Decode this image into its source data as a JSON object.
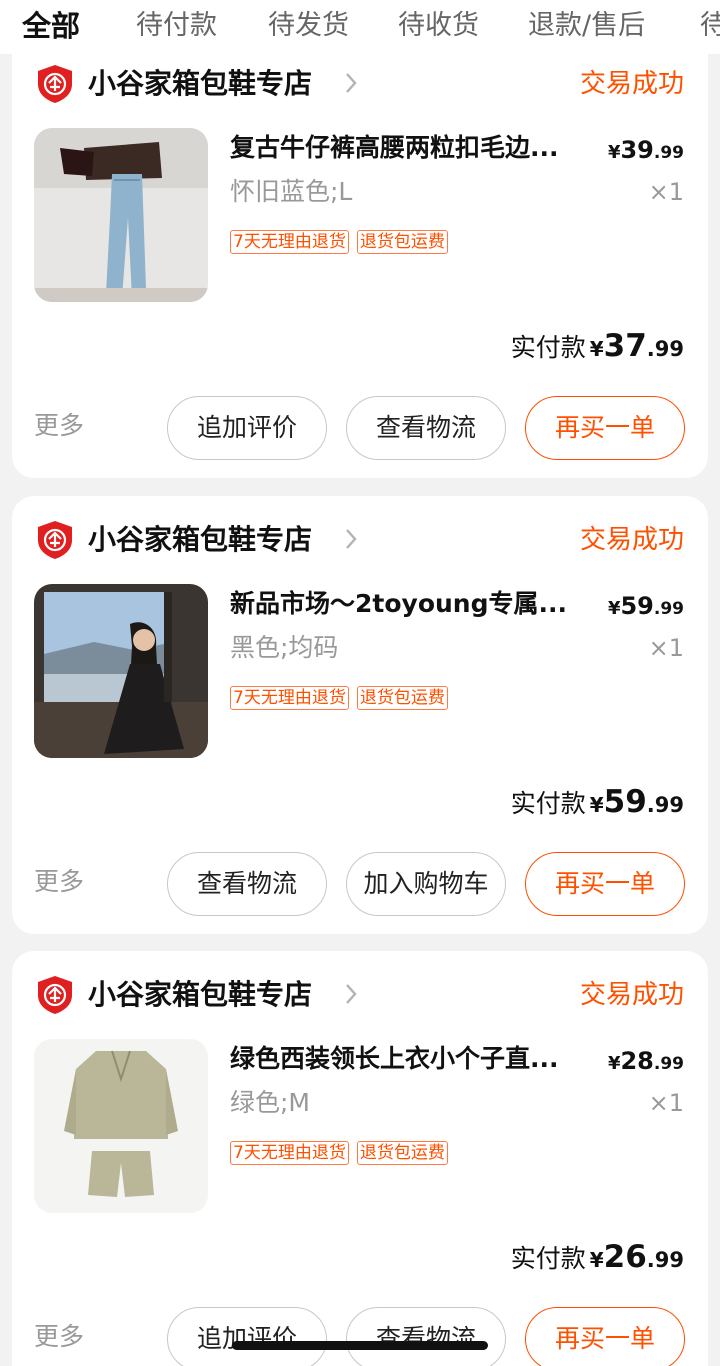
{
  "tabs": [
    "全部",
    "待付款",
    "待发货",
    "待收货",
    "退款/售后",
    "待"
  ],
  "orders": [
    {
      "shop_name": "小谷家箱包鞋专店",
      "status": "交易成功",
      "item_title": "复古牛仔裤高腰两粒扣毛边...",
      "price_currency": "¥",
      "price_int": "39",
      "price_dec": ".99",
      "spec": "怀旧蓝色;L",
      "qty": "×1",
      "tags": [
        "7天无理由退货",
        "退货包运费"
      ],
      "paid_label": "实付款",
      "paid_currency": "¥",
      "paid_int": "37",
      "paid_dec": ".99",
      "more_label": "更多",
      "buttons": [
        "追加评价",
        "查看物流",
        "再买一单"
      ]
    },
    {
      "shop_name": "小谷家箱包鞋专店",
      "status": "交易成功",
      "item_title": "新品市场～2toyoung专属...",
      "price_currency": "¥",
      "price_int": "59",
      "price_dec": ".99",
      "spec": "黑色;均码",
      "qty": "×1",
      "tags": [
        "7天无理由退货",
        "退货包运费"
      ],
      "paid_label": "实付款",
      "paid_currency": "¥",
      "paid_int": "59",
      "paid_dec": ".99",
      "more_label": "更多",
      "buttons": [
        "查看物流",
        "加入购物车",
        "再买一单"
      ]
    },
    {
      "shop_name": "小谷家箱包鞋专店",
      "status": "交易成功",
      "item_title": "绿色西装领长上衣小个子直...",
      "price_currency": "¥",
      "price_int": "28",
      "price_dec": ".99",
      "spec": "绿色;M",
      "qty": "×1",
      "tags": [
        "7天无理由退货",
        "退货包运费"
      ],
      "paid_label": "实付款",
      "paid_currency": "¥",
      "paid_int": "26",
      "paid_dec": ".99",
      "more_label": "更多",
      "buttons": [
        "追加评价",
        "查看物流",
        "再买一单"
      ]
    }
  ],
  "colors": {
    "accent": "#ff5000",
    "muted_text": "#999999",
    "shop_badge": "#e02020"
  },
  "icons": {
    "shop_badge": "enterprise-shield-icon",
    "shop_arrow": "chevron-right-icon"
  }
}
